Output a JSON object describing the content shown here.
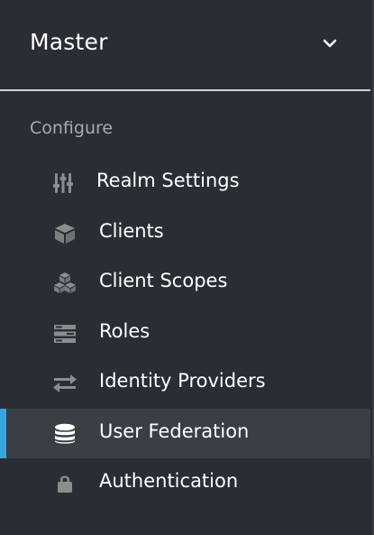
{
  "realm": {
    "name": "Master",
    "dropdown_icon": "chevron-down-icon"
  },
  "section": {
    "label": "Configure"
  },
  "nav_items": [
    {
      "label": "Realm Settings",
      "icon": "sliders-icon",
      "active": false
    },
    {
      "label": "Clients",
      "icon": "cube-icon",
      "active": false
    },
    {
      "label": "Client Scopes",
      "icon": "cubes-icon",
      "active": false
    },
    {
      "label": "Roles",
      "icon": "list-icon",
      "active": false
    },
    {
      "label": "Identity Providers",
      "icon": "exchange-icon",
      "active": false
    },
    {
      "label": "User Federation",
      "icon": "database-icon",
      "active": true
    },
    {
      "label": "Authentication",
      "icon": "lock-icon",
      "active": false
    }
  ],
  "colors": {
    "background": "#292e34",
    "active_background": "#393f44",
    "active_indicator": "#39a5dc",
    "icon_color": "#8b8d8f",
    "active_icon_color": "#ffffff"
  }
}
